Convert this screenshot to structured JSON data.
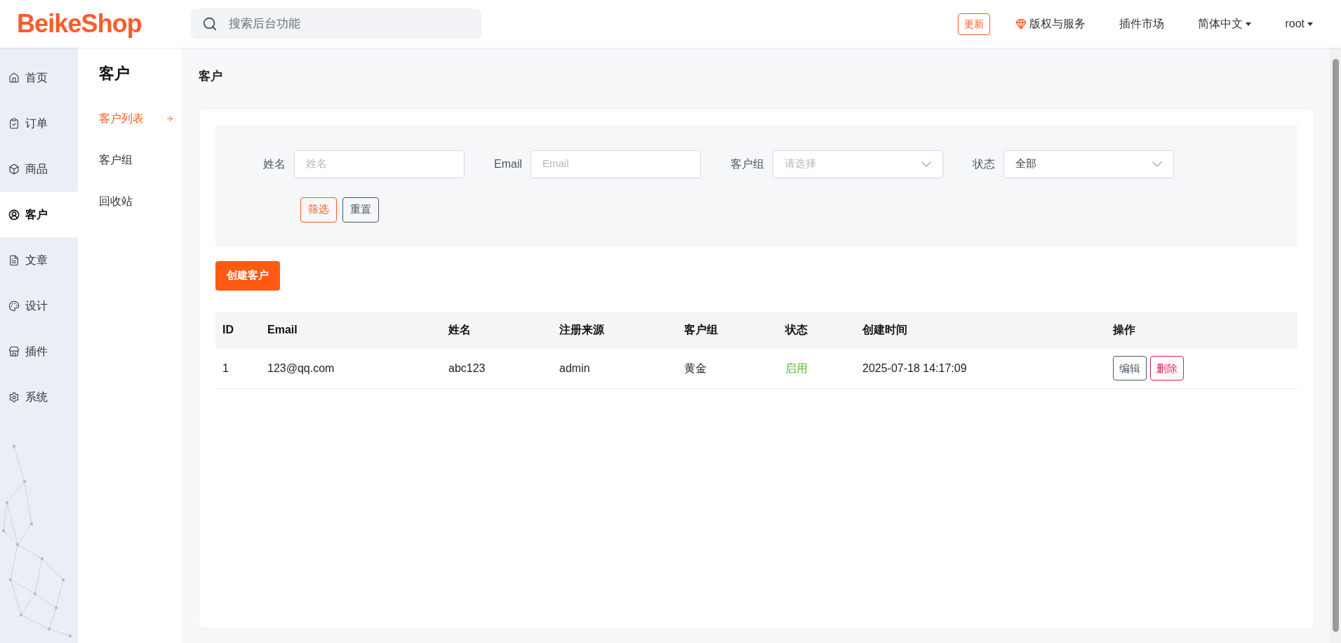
{
  "header": {
    "logo": "BeikeShop",
    "search": {
      "placeholder": "搜索后台功能"
    },
    "update_badge": "更新",
    "links": [
      {
        "label": "版权与服务",
        "kind": "gem"
      },
      {
        "label": "插件市场",
        "kind": "plain"
      },
      {
        "label": "简体中文",
        "kind": "dropdown"
      },
      {
        "label": "root",
        "kind": "dropdown"
      }
    ]
  },
  "sidebar": {
    "items": [
      {
        "label": "首页",
        "selected": false
      },
      {
        "label": "订单",
        "selected": false
      },
      {
        "label": "商品",
        "selected": false
      },
      {
        "label": "客户",
        "selected": true
      },
      {
        "label": "文章",
        "selected": false
      },
      {
        "label": "设计",
        "selected": false
      },
      {
        "label": "插件",
        "selected": false
      },
      {
        "label": "系统",
        "selected": false
      }
    ]
  },
  "submenu": {
    "title": "客户",
    "items": [
      {
        "label": "客户列表",
        "selected": true
      },
      {
        "label": "客户组",
        "selected": false
      },
      {
        "label": "回收站",
        "selected": false
      }
    ]
  },
  "page_title": "客户",
  "filter": {
    "fields": [
      {
        "label": "姓名",
        "kind": "text",
        "placeholder": "姓名"
      },
      {
        "label": "Email",
        "kind": "text",
        "placeholder": "Email"
      },
      {
        "label": "客户组",
        "kind": "select",
        "placeholder": "请选择"
      },
      {
        "label": "状态",
        "kind": "select",
        "value": "全部"
      }
    ],
    "buttons": [
      {
        "label": "筛选",
        "kind": "primary"
      },
      {
        "label": "重置",
        "kind": "default"
      }
    ]
  },
  "create_button": "创建客户",
  "table": {
    "columns": [
      "ID",
      "Email",
      "姓名",
      "注册来源",
      "客户组",
      "状态",
      "创建时间",
      "操作"
    ],
    "rows": [
      {
        "id": "1",
        "email": "123@qq.com",
        "name": "abc123",
        "source": "admin",
        "group": "黄金",
        "status": "启用",
        "enabled": true,
        "created": "2025-07-18 14:17:09",
        "actions": [
          {
            "label": "编辑",
            "kind": "edit"
          },
          {
            "label": "删除",
            "kind": "delete"
          }
        ]
      }
    ]
  }
}
